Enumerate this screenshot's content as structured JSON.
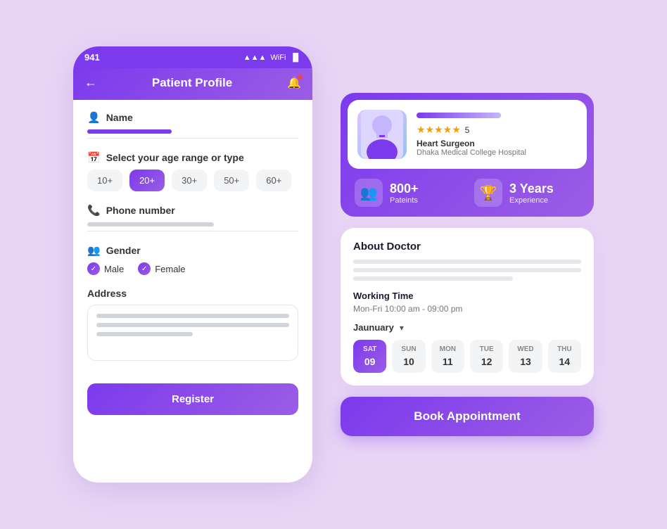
{
  "left": {
    "status_bar": {
      "time": "941",
      "icons": [
        "signal",
        "wifi",
        "battery"
      ]
    },
    "header": {
      "title": "Patient Profile",
      "back_label": "←",
      "bell_icon": "🔔"
    },
    "form": {
      "name_label": "Name",
      "name_icon": "👤",
      "age_label": "Select your age range or type",
      "age_icon": "📅",
      "age_options": [
        "10+",
        "20+",
        "30+",
        "50+",
        "60+"
      ],
      "active_age": "20+",
      "phone_label": "Phone number",
      "phone_icon": "📞",
      "gender_label": "Gender",
      "gender_icon": "👥",
      "genders": [
        "Male",
        "Female"
      ],
      "address_label": "Address",
      "register_btn": "Register"
    }
  },
  "right": {
    "doctor": {
      "specialty": "Heart Surgeon",
      "hospital": "Dhaka Medical College Hospital",
      "stars": "★★★★★",
      "star_count": "5",
      "stats": [
        {
          "value": "800+",
          "label": "Pateints",
          "icon": "👥"
        },
        {
          "value": "3 Years",
          "label": "Experience",
          "icon": "🏆"
        }
      ]
    },
    "about": {
      "title": "About Doctor",
      "working_time_title": "Working Time",
      "working_time": "Mon-Fri 10:00 am - 09:00 pm",
      "month": "Jaunuary",
      "dates": [
        {
          "day": "SAT",
          "num": "09",
          "active": true
        },
        {
          "day": "SUN",
          "num": "10",
          "active": false
        },
        {
          "day": "MON",
          "num": "11",
          "active": false
        },
        {
          "day": "TUE",
          "num": "12",
          "active": false
        },
        {
          "day": "WED",
          "num": "13",
          "active": false
        },
        {
          "day": "THU",
          "num": "14",
          "active": false
        }
      ]
    },
    "book_btn": "Book Appointment"
  }
}
